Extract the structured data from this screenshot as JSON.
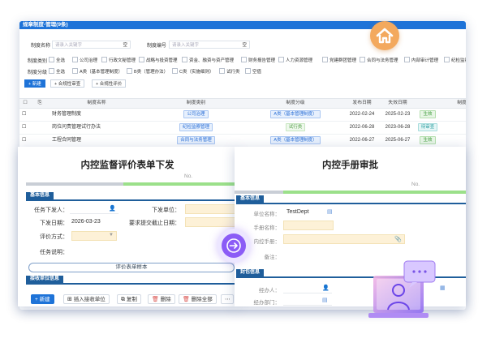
{
  "list_window": {
    "title": "规章制度-管理(9条)",
    "search": [
      {
        "label": "制度名称",
        "placeholder": "请录入关键字",
        "suffix": "空"
      },
      {
        "label": "制度编号",
        "placeholder": "请录入关键字",
        "suffix": "空"
      }
    ],
    "category": {
      "label": "制度类别",
      "options": [
        "全选",
        "公司治理",
        "行政文秘管理",
        "战略与投资管理",
        "资金、融资与资产管理",
        "财务报告管理",
        "人力资源管理",
        "党建群团管理",
        "合同与法务管理",
        "内部审计管理",
        "纪检监察"
      ]
    },
    "level": {
      "label": "制度分级",
      "options": [
        "全选",
        "A类（基本管理制度）",
        "B类（管理办法）",
        "C类（实施细则）",
        "试行类",
        "空值"
      ]
    },
    "toolbar": {
      "new": "+ 新建",
      "review": "+ 合规性审查",
      "evaluate": "+ 合规性评价"
    },
    "columns": [
      "制度名称",
      "制度类别",
      "制度分级",
      "发布日期",
      "失效日期",
      "制度"
    ],
    "rows": [
      {
        "name": "财务管理制度",
        "category": "公司治理",
        "level": "A类（基本管理制度）",
        "publish": "2022-02-24",
        "expire": "2025-02-23",
        "status": "生效"
      },
      {
        "name": "岗位问责管理试行办法",
        "category": "纪检监察管理",
        "level": "试行类",
        "publish": "2022-06-28",
        "expire": "2023-06-28",
        "status": "待审查"
      },
      {
        "name": "工程合同管理",
        "category": "合同与法务管理",
        "level": "A类（基本管理制度）",
        "publish": "2022-06-27",
        "expire": "2025-06-27",
        "status": "生效"
      }
    ]
  },
  "form_a": {
    "title": "内控监督评价表单下发",
    "no_label": "No.",
    "section_basic": "基本信息",
    "fields": {
      "issuer_label": "任务下发人：",
      "unit_label": "下发单位：",
      "date_label": "下发日期：",
      "date_value": "2026-03-23",
      "deadline_label": "要求提交截止日期：",
      "method_label": "评价方式：",
      "desc_label": "任务说明："
    },
    "sample_button": "评价表单样本",
    "section_receive": "接收单位信息",
    "toolbar": [
      "+ 新建",
      "插入接收单位",
      "复制",
      "删除",
      "删除全部"
    ]
  },
  "form_b": {
    "title": "内控手册审批",
    "no_label": "No.",
    "section_basic": "基本信息",
    "fields": {
      "unit_label": "单位名称：",
      "unit_value": "TestDept",
      "manual_name_label": "手册名称：",
      "manual_label": "内控手册：",
      "note_label": "备注："
    },
    "section_sign": "封包信息",
    "sign_fields": {
      "handler_label": "经办人：",
      "dept_label": "经办部门："
    }
  },
  "icons": {
    "home": "home-icon",
    "arrow": "arrow-right-icon",
    "video": "presenter-chat-icon"
  },
  "colors": {
    "primary": "#1e73d8",
    "section": "#1f5e9b",
    "accent_purple": "#8b5cf6",
    "home_orange": "#f3a95e"
  }
}
